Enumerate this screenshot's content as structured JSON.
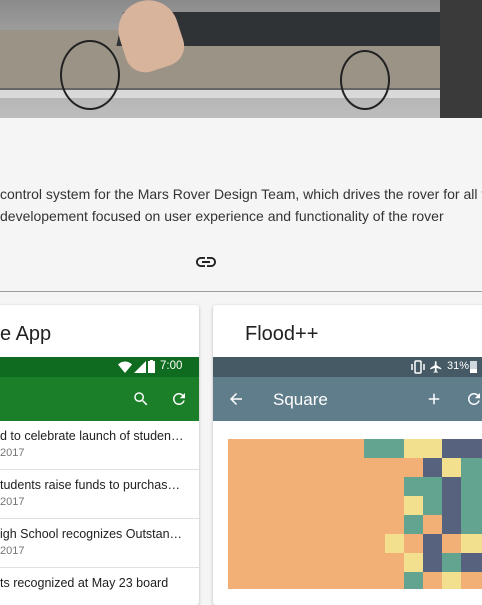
{
  "description": {
    "line1": "control system for the Mars Rover Design Team, which drives the rover for all ta",
    "line2": "developement focused on user experience and functionality of the rover"
  },
  "cards": {
    "left": {
      "title": "e App",
      "status_time": "7:00",
      "accent": "#1b7f2a",
      "status_bar_color": "#0f6b1f",
      "news": [
        {
          "title": "d to celebrate launch of student-...",
          "date": "2017"
        },
        {
          "title": "tudents raise funds to purchase ...",
          "date": "2017"
        },
        {
          "title": "igh School recognizes Outstand...",
          "date": "2017"
        },
        {
          "title": "ts recognized at May 23 board",
          "date": ""
        }
      ]
    },
    "right": {
      "title": "Flood++",
      "battery": "31%",
      "toolbar_title": "Square",
      "toolbar_color": "#607d8b",
      "status_bar_color": "#455a64",
      "board_colors": [
        "#f2b076",
        "#f3e08f",
        "#63a491",
        "#56627e"
      ]
    }
  },
  "icons": [
    "link-icon",
    "search-icon",
    "refresh-icon",
    "back-arrow-icon",
    "add-icon",
    "wifi-icon",
    "signal-icon",
    "battery-icon",
    "vibrate-icon",
    "airplane-icon"
  ]
}
